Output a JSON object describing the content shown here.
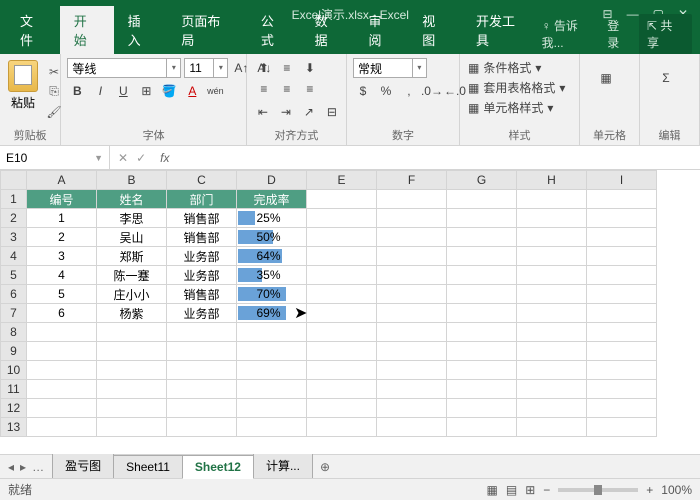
{
  "app": {
    "title": "Excel演示.xlsx - Excel"
  },
  "tabs": {
    "file": "文件",
    "home": "开始",
    "insert": "插入",
    "layout": "页面布局",
    "formula": "公式",
    "data": "数据",
    "review": "审阅",
    "view": "视图",
    "dev": "开发工具",
    "tell": "告诉我...",
    "login": "登录",
    "share": "共享"
  },
  "ribbon": {
    "clipboard": {
      "label": "剪贴板",
      "paste": "粘贴"
    },
    "font": {
      "label": "字体",
      "name": "等线",
      "size": "11"
    },
    "align": {
      "label": "对齐方式"
    },
    "number": {
      "label": "数字",
      "format": "常规"
    },
    "styles": {
      "label": "样式",
      "cond": "条件格式",
      "table": "套用表格格式",
      "cell": "单元格样式"
    },
    "cells": {
      "label": "单元格"
    },
    "editing": {
      "label": "编辑"
    }
  },
  "namebox": "E10",
  "cols": [
    "A",
    "B",
    "C",
    "D",
    "E",
    "F",
    "G",
    "H",
    "I"
  ],
  "headers": [
    "编号",
    "姓名",
    "部门",
    "完成率"
  ],
  "rows": [
    {
      "n": "1",
      "name": "李思",
      "dept": "销售部",
      "rate": 25
    },
    {
      "n": "2",
      "name": "吴山",
      "dept": "销售部",
      "rate": 50
    },
    {
      "n": "3",
      "name": "郑斯",
      "dept": "业务部",
      "rate": 64
    },
    {
      "n": "4",
      "name": "陈一蹇",
      "dept": "业务部",
      "rate": 35
    },
    {
      "n": "5",
      "name": "庄小小",
      "dept": "销售部",
      "rate": 70
    },
    {
      "n": "6",
      "name": "杨紫",
      "dept": "业务部",
      "rate": 69
    }
  ],
  "sheets": {
    "s1": "盈亏图",
    "s2": "Sheet11",
    "s3": "Sheet12",
    "s4": "计算..."
  },
  "status": {
    "ready": "就绪",
    "zoom": "100%"
  }
}
